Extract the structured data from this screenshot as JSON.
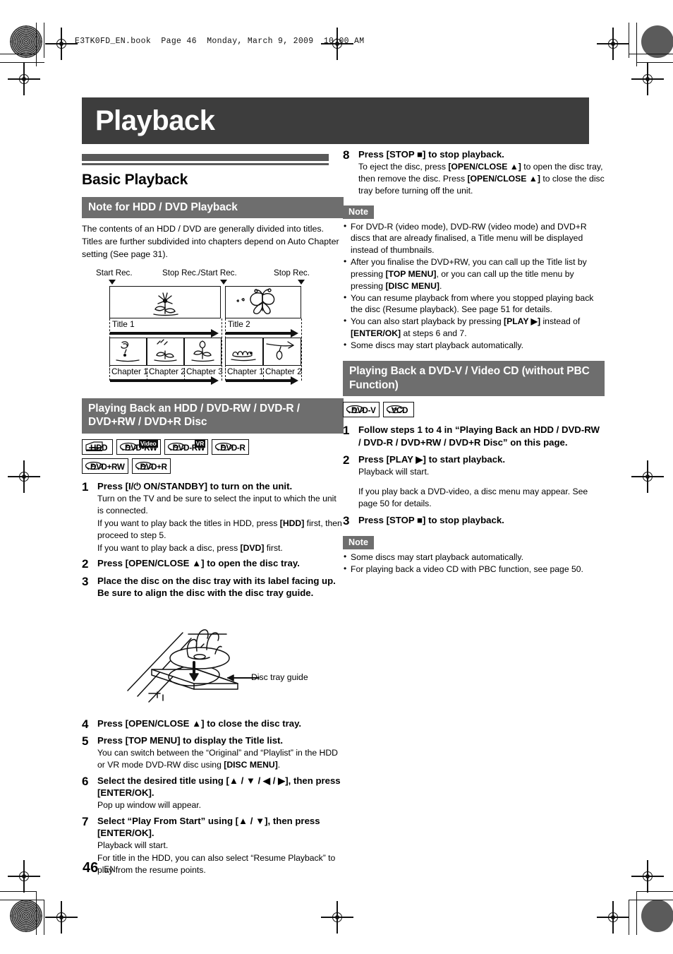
{
  "running_head": "E3TK0FD_EN.book  Page 46  Monday, March 9, 2009  10:00 AM",
  "chapter_title": "Playback",
  "footer": {
    "page_number": "46",
    "language": "EN"
  },
  "left_column": {
    "section_title": "Basic Playback",
    "subsection_1_title": "Note for HDD / DVD Playback",
    "intro_paragraph": "The contents of an HDD / DVD are generally divided into titles. Titles are further subdivided into chapters depend on Auto Chapter setting (See page 31).",
    "diagram": {
      "markers": [
        "Start Rec.",
        "Stop Rec./Start Rec.",
        "Stop Rec."
      ],
      "titles": [
        "Title 1",
        "Title 2"
      ],
      "title1_chapters": [
        "Chapter 1",
        "Chapter 2",
        "Chapter 3"
      ],
      "title2_chapters": [
        "Chapter 1",
        "Chapter 2"
      ]
    },
    "subsection_2_title": "Playing Back an HDD / DVD-RW / DVD-R / DVD+RW / DVD+R Disc",
    "badges_row1": [
      {
        "label": "HDD",
        "sup": "",
        "icon": "hdd-icon"
      },
      {
        "label": "DVD-RW",
        "sup": "Video",
        "icon": "disc-icon"
      },
      {
        "label": "DVD-RW",
        "sup": "VR",
        "icon": "disc-icon"
      },
      {
        "label": "DVD-R",
        "sup": "",
        "icon": "disc-icon"
      }
    ],
    "badges_row2": [
      {
        "label": "DVD+RW",
        "sup": "",
        "icon": "disc-icon"
      },
      {
        "label": "DVD+R",
        "sup": "",
        "icon": "disc-icon"
      }
    ],
    "steps": [
      {
        "num": "1",
        "lead": "Press [I/⏻ ON/STANDBY] to turn on the unit.",
        "subs": [
          "Turn on the TV and be sure to select the input to which the unit is connected.",
          "If you want to play back the titles in HDD, press [HDD] first, then proceed to step 5.",
          "If you want to play back a disc, press [DVD] first."
        ]
      },
      {
        "num": "2",
        "lead": "Press [OPEN/CLOSE ▲] to open the disc tray.",
        "subs": []
      },
      {
        "num": "3",
        "lead": "Place the disc on the disc tray with its label facing up. Be sure to align the disc with the disc tray guide.",
        "subs": []
      },
      {
        "num": "4",
        "lead": "Press [OPEN/CLOSE ▲] to close the disc tray.",
        "subs": []
      },
      {
        "num": "5",
        "lead": "Press [TOP MENU] to display the Title list.",
        "subs": [
          "You can switch between the “Original” and “Playlist” in the HDD or VR mode DVD-RW disc using [DISC MENU]."
        ]
      },
      {
        "num": "6",
        "lead": "Select the desired title using [▲ / ▼ / ◀ / ▶], then press [ENTER/OK].",
        "subs": [
          "Pop up window will appear."
        ]
      },
      {
        "num": "7",
        "lead": "Select “Play From Start” using [▲ / ▼], then press [ENTER/OK].",
        "subs": [
          "Playback will start.",
          "For title in the HDD, you can also select “Resume Playback” to play from the resume points."
        ]
      }
    ],
    "tray_illustration_label": "Disc tray guide"
  },
  "right_column": {
    "step_8": {
      "num": "8",
      "lead": "Press [STOP ■] to stop playback.",
      "sub": "To eject the disc, press [OPEN/CLOSE ▲] to open the disc tray, then remove the disc. Press [OPEN/CLOSE ▲] to close the disc tray before turning off the unit."
    },
    "note_label_1": "Note",
    "notes_1": [
      "For DVD-R (video mode), DVD-RW (video mode) and DVD+R discs that are already finalised, a Title menu will be displayed instead of thumbnails.",
      "After you finalise the DVD+RW, you can call up the Title list by pressing [TOP MENU], or you can call up the title menu by pressing [DISC MENU].",
      "You can resume playback from where you stopped playing back the disc (Resume playback). See page 51 for details.",
      "You can also start playback by pressing [PLAY ▶] instead of [ENTER/OK] at steps 6 and 7.",
      "Some discs may start playback automatically."
    ],
    "subsection_title": "Playing Back a DVD-V / Video CD (without PBC Function)",
    "badges": [
      {
        "label": "DVD-V",
        "sup": "",
        "icon": "disc-icon"
      },
      {
        "label": "VCD",
        "sup": "",
        "icon": "disc-icon"
      }
    ],
    "steps": [
      {
        "num": "1",
        "lead": "Follow steps 1 to 4 in “Playing Back an HDD / DVD-RW / DVD-R / DVD+RW / DVD+R Disc” on this page.",
        "subs": []
      },
      {
        "num": "2",
        "lead": "Press [PLAY ▶] to start playback.",
        "subs": [
          "Playback will start.",
          "If you play back a DVD-video, a disc menu may appear. See page 50 for details."
        ]
      },
      {
        "num": "3",
        "lead": "Press [STOP ■] to stop playback.",
        "subs": []
      }
    ],
    "note_label_2": "Note",
    "notes_2": [
      "Some discs may start playback automatically.",
      "For playing back a video CD with PBC function, see page 50."
    ]
  },
  "colors": {
    "banner_bg": "#3d3d3d",
    "subbar_bg": "#6e6e6e",
    "rule_gray": "#595959"
  }
}
